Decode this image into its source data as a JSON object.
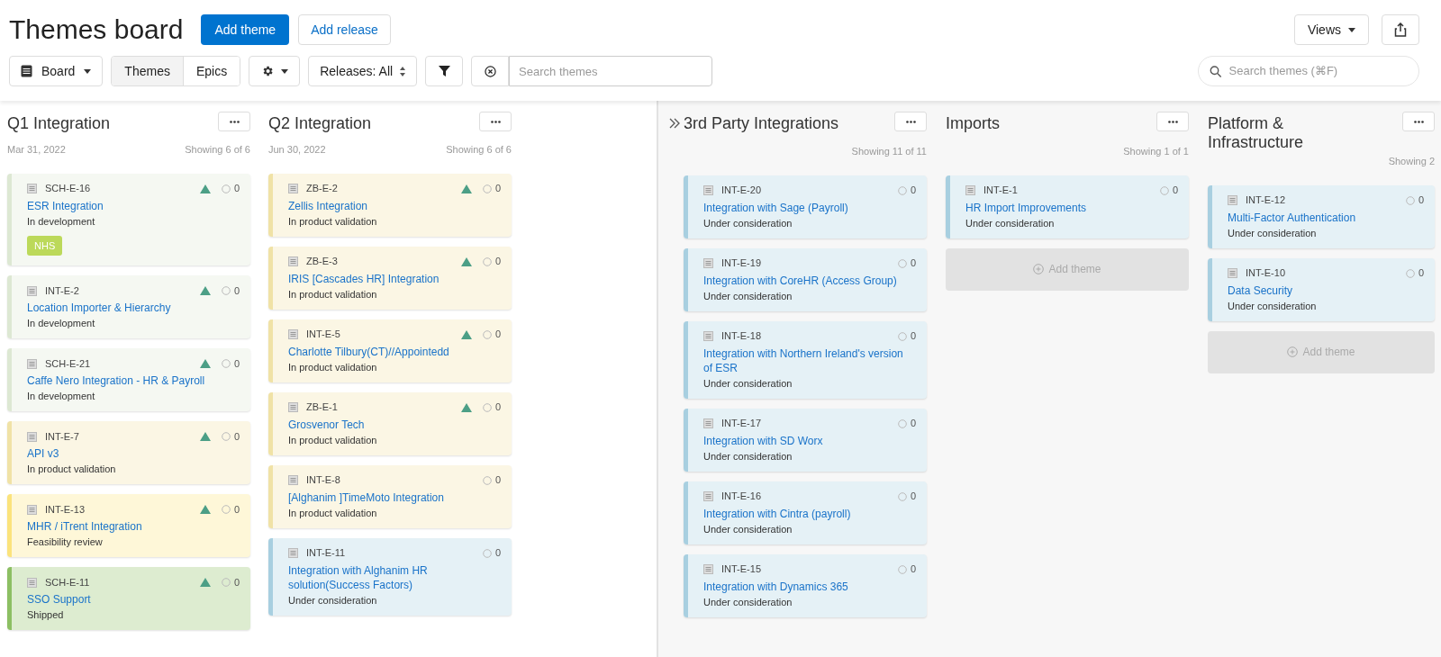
{
  "title": "Themes board",
  "header_buttons": [
    {
      "label": "Add theme",
      "kind": "primary"
    },
    {
      "label": "Add release",
      "kind": "secondary"
    }
  ],
  "views_button": {
    "label": "Views"
  },
  "toolbar": {
    "view_dropdown": "Board",
    "segments": [
      {
        "label": "Themes",
        "selected": true
      },
      {
        "label": "Epics",
        "selected": false
      }
    ],
    "releases_select": "Releases: All",
    "search": {
      "placeholder": "Search themes"
    }
  },
  "global_search": {
    "placeholder": "Search themes (⌘F)"
  },
  "release_columns": [
    {
      "title": "Q1 Integration",
      "date": "Mar 31, 2022",
      "count": "Showing 6 of 6",
      "cards": [
        {
          "id": "SCH-E-16",
          "title": "ESR Integration",
          "status": "In development",
          "color": "#dde8d3",
          "marker": true,
          "comments": "0",
          "tag": "NHS"
        },
        {
          "id": "INT-E-2",
          "title": "Location Importer & Hierarchy",
          "status": "In development",
          "color": "#dde8d3",
          "marker": true,
          "comments": "0"
        },
        {
          "id": "SCH-E-21",
          "title": "Caffe Nero Integration - HR & Payroll",
          "status": "In development",
          "color": "#dde8d3",
          "marker": true,
          "comments": "0"
        },
        {
          "id": "INT-E-7",
          "title": "API v3",
          "status": "In product validation",
          "color": "#f0e2a6",
          "marker": true,
          "comments": "0"
        },
        {
          "id": "INT-E-13",
          "title": "MHR / iTrent Integration",
          "status": "Feasibility review",
          "color": "#fbe37c",
          "marker": true,
          "comments": "0"
        },
        {
          "id": "SCH-E-11",
          "title": "SSO Support",
          "status": "Shipped",
          "color": "#8cbf63",
          "marker": true,
          "comments": "0"
        }
      ]
    },
    {
      "title": "Q2 Integration",
      "date": "Jun 30, 2022",
      "count": "Showing 6 of 6",
      "cards": [
        {
          "id": "ZB-E-2",
          "title": "Zellis Integration",
          "status": "In product validation",
          "color": "#f0e2a6",
          "marker": true,
          "comments": "0"
        },
        {
          "id": "ZB-E-3",
          "title": "IRIS [Cascades HR] Integration",
          "status": "In product validation",
          "color": "#f0e2a6",
          "marker": true,
          "comments": "0"
        },
        {
          "id": "INT-E-5",
          "title": "Charlotte Tilbury(CT)//Appointedd",
          "status": "In product validation",
          "color": "#f0e2a6",
          "marker": true,
          "comments": "0"
        },
        {
          "id": "ZB-E-1",
          "title": "Grosvenor Tech",
          "status": "In product validation",
          "color": "#f0e2a6",
          "marker": true,
          "comments": "0"
        },
        {
          "id": "INT-E-8",
          "title": "[Alghanim ]TimeMoto Integration",
          "status": "In product validation",
          "color": "#f0e2a6",
          "marker": false,
          "comments": "0"
        },
        {
          "id": "INT-E-11",
          "title": "Integration with Alghanim HR solution(Success Factors)",
          "status": "Under consideration",
          "color": "#a8cfe0",
          "marker": false,
          "comments": "0"
        }
      ]
    }
  ],
  "theme_columns": [
    {
      "title": "3rd Party Integrations",
      "expand_icon": true,
      "count": "Showing 11 of 11",
      "cards": [
        {
          "id": "INT-E-20",
          "title": "Integration with Sage (Payroll)",
          "status": "Under consideration",
          "color": "#a8cfe0",
          "marker": false,
          "comments": "0"
        },
        {
          "id": "INT-E-19",
          "title": "Integration with CoreHR (Access Group)",
          "status": "Under consideration",
          "color": "#a8cfe0",
          "marker": false,
          "comments": "0"
        },
        {
          "id": "INT-E-18",
          "title": "Integration with Northern Ireland's version of ESR",
          "status": "Under consideration",
          "color": "#a8cfe0",
          "marker": false,
          "comments": "0"
        },
        {
          "id": "INT-E-17",
          "title": "Integration with SD Worx",
          "status": "Under consideration",
          "color": "#a8cfe0",
          "marker": false,
          "comments": "0"
        },
        {
          "id": "INT-E-16",
          "title": "Integration with Cintra (payroll)",
          "status": "Under consideration",
          "color": "#a8cfe0",
          "marker": false,
          "comments": "0"
        },
        {
          "id": "INT-E-15",
          "title": "Integration with Dynamics 365",
          "status": "Under consideration",
          "color": "#a8cfe0",
          "marker": false,
          "comments": "0"
        }
      ]
    },
    {
      "title": "Imports",
      "expand_icon": false,
      "count": "Showing 1 of 1",
      "cards": [
        {
          "id": "INT-E-1",
          "title": "HR Import Improvements",
          "status": "Under consideration",
          "color": "#a8cfe0",
          "marker": false,
          "comments": "0"
        }
      ],
      "add_button": "Add theme"
    },
    {
      "title": "Platform & Infrastructure",
      "expand_icon": false,
      "count": "Showing 2",
      "cards": [
        {
          "id": "INT-E-12",
          "title": "Multi-Factor Authentication",
          "status": "Under consideration",
          "color": "#a8cfe0",
          "marker": false,
          "comments": "0"
        },
        {
          "id": "INT-E-10",
          "title": "Data Security",
          "status": "Under consideration",
          "color": "#a8cfe0",
          "marker": false,
          "comments": "0"
        }
      ],
      "add_button": "Add theme"
    }
  ]
}
